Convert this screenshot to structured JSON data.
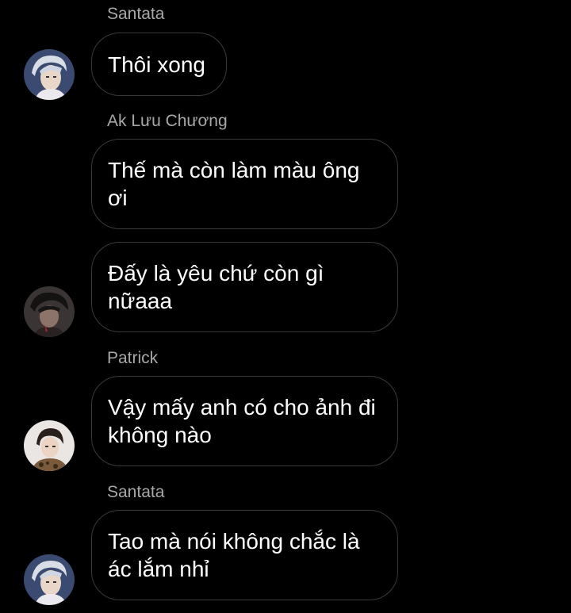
{
  "messages": [
    {
      "sender": "Santata",
      "text": "Thôi xong"
    },
    {
      "sender": "Ak Lưu Chương",
      "text": "Thế mà còn làm màu ông ơi"
    },
    {
      "sender": "",
      "text": "Đấy là yêu chứ còn gì nữaaa"
    },
    {
      "sender": "Patrick",
      "text": "Vậy mấy anh có cho ảnh đi không nào"
    },
    {
      "sender": "Santata",
      "text": "Tao mà nói không chắc là ác lắm nhỉ"
    }
  ],
  "avatars": [
    {
      "icon": "user-avatar-santata",
      "background": "#3b4a70"
    },
    {
      "icon": "user-avatar-ak-luu-chuong",
      "background": "#3a3434"
    },
    {
      "icon": "user-avatar-patrick",
      "background": "#e9e6e3"
    },
    {
      "icon": "user-avatar-santata",
      "background": "#3b4a70"
    }
  ],
  "colors": {
    "background": "#000000",
    "bubble_border": "#3a3a3a",
    "sender_text": "#a8a8a8",
    "message_text": "#ffffff"
  }
}
